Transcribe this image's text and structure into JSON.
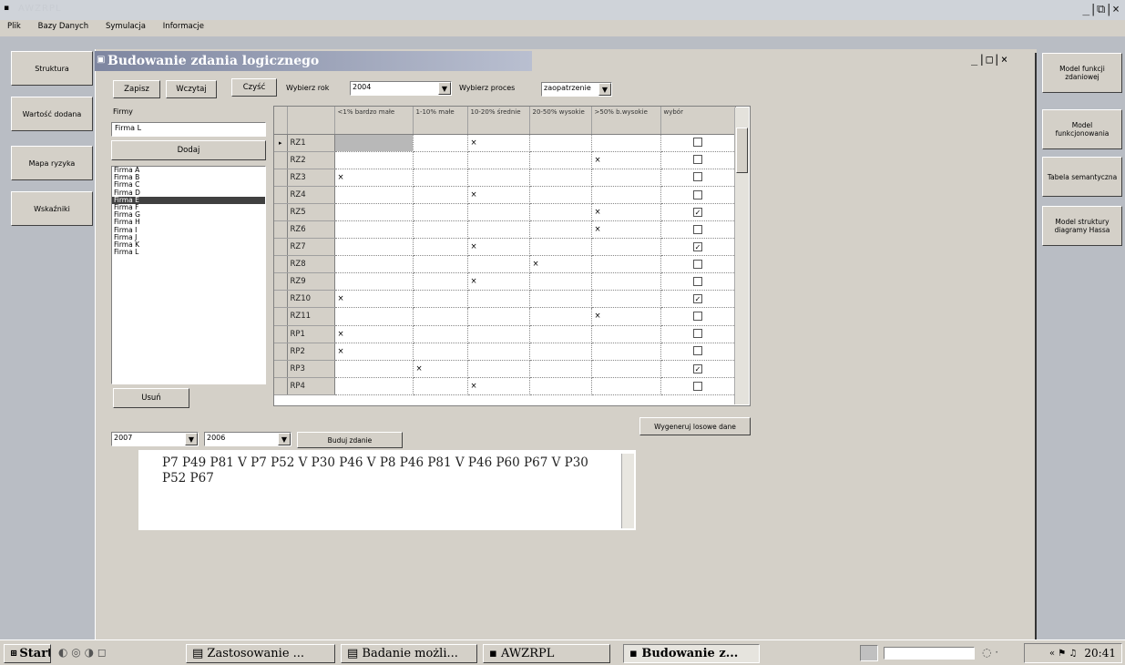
{
  "app": {
    "title": "AWZRPL"
  },
  "menu": [
    "Plik",
    "Bazy Danych",
    "Symulacja",
    "Informacje"
  ],
  "left_nav": [
    "Struktura",
    "Wartość dodana",
    "Mapa ryzyka",
    "Wskaźniki"
  ],
  "right_nav": [
    "Model funkcji zdaniowej",
    "Model funkcjonowania",
    "Tabela semantyczna",
    "Model struktury diagramy Hassa"
  ],
  "inner_window": {
    "title": "Budowanie zdania logicznego",
    "controls": "_|□|×"
  },
  "toolbar": {
    "save": "Zapisz",
    "load": "Wczytaj",
    "clear": "Czyść",
    "year_label": "Wybierz rok",
    "year_value": "2004",
    "process_label": "Wybierz proces",
    "process_value": "zaopatrzenie"
  },
  "firms": {
    "label": "Firmy",
    "input_value": "Firma L",
    "add": "Dodaj",
    "list": [
      "Firma A",
      "Firma B",
      "Firma C",
      "Firma D",
      "Firma E",
      "Firma F",
      "Firma G",
      "Firma H",
      "Firma I",
      "Firma J",
      "Firma K",
      "Firma L"
    ],
    "selected_index": 4,
    "remove": "Usuń"
  },
  "grid": {
    "columns": [
      "<1% bardzo małe",
      "1-10% małe",
      "10-20% średnie",
      "20-50% wysokie",
      ">50% b.wysokie",
      "wybór"
    ],
    "rows": [
      {
        "name": "RZ1",
        "mark": 3,
        "checked": false
      },
      {
        "name": "RZ2",
        "mark": 5,
        "checked": false
      },
      {
        "name": "RZ3",
        "mark": 1,
        "checked": false
      },
      {
        "name": "RZ4",
        "mark": 3,
        "checked": false
      },
      {
        "name": "RZ5",
        "mark": 5,
        "checked": true
      },
      {
        "name": "RZ6",
        "mark": 5,
        "checked": false
      },
      {
        "name": "RZ7",
        "mark": 3,
        "checked": true
      },
      {
        "name": "RZ8",
        "mark": 4,
        "checked": false
      },
      {
        "name": "RZ9",
        "mark": 3,
        "checked": false
      },
      {
        "name": "RZ10",
        "mark": 1,
        "checked": true
      },
      {
        "name": "RZ11",
        "mark": 5,
        "checked": false
      },
      {
        "name": "RP1",
        "mark": 1,
        "checked": false
      },
      {
        "name": "RP2",
        "mark": 1,
        "checked": false
      },
      {
        "name": "RP3",
        "mark": 2,
        "checked": true
      },
      {
        "name": "RP4",
        "mark": 3,
        "checked": false
      }
    ],
    "mark_symbol": "×",
    "check_symbol": "✓"
  },
  "generate": "Wygeneruj losowe dane",
  "bottom": {
    "year_from": "2007",
    "year_to": "2006",
    "build": "Buduj zdanie"
  },
  "result_text": "P7 P49 P81 V P7 P52 V P30 P46 V P8 P46 P81 V P46 P60 P67 V P30 P52 P67",
  "taskbar": {
    "start": "Start",
    "tasks": [
      "Zastosowanie ...",
      "Badanie możli...",
      "AWZRPL",
      "Budowanie z..."
    ],
    "clock": "20:41"
  }
}
